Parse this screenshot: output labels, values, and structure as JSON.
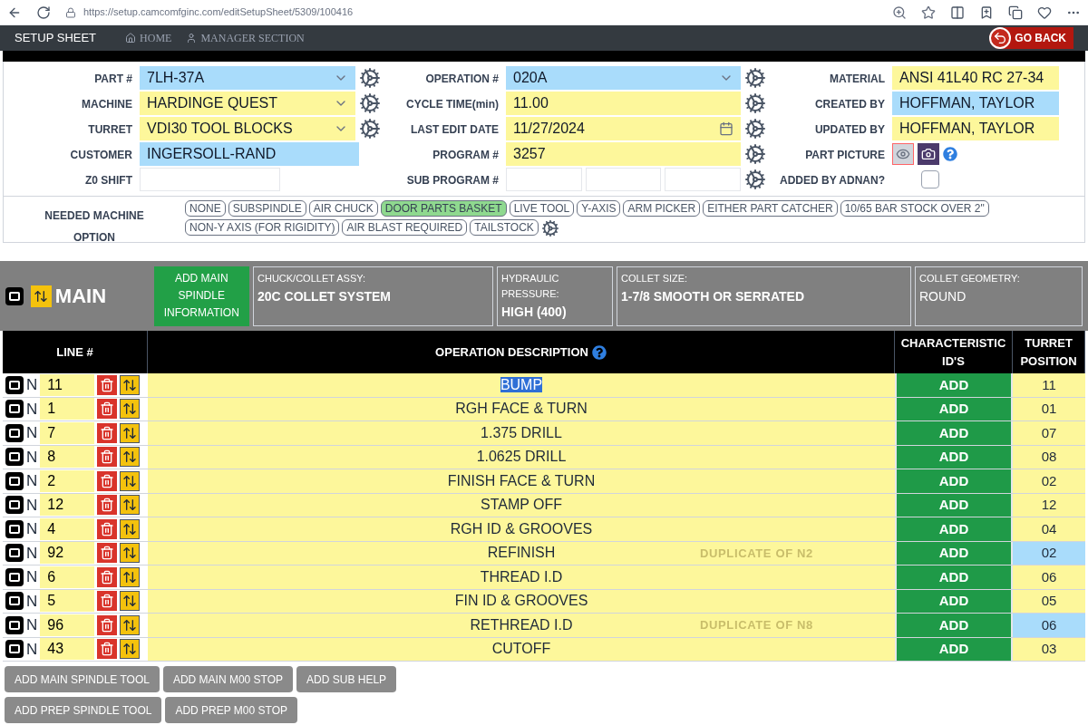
{
  "browser": {
    "url": "https://setup.camcomfginc.com/editSetupSheet/5309/100416"
  },
  "nav": {
    "title": "SETUP SHEET",
    "links": [
      "HOME",
      "MANAGER SECTION"
    ],
    "back_button": "GO BACK"
  },
  "general": {
    "columns": [
      [
        {
          "label": "PART #",
          "value": "7LH-37A",
          "kind": "select",
          "color": "#a9dcfb",
          "gear": true
        },
        {
          "label": "MACHINE",
          "value": "HARDINGE QUEST",
          "kind": "select",
          "color": "#fdf79b",
          "gear": true
        },
        {
          "label": "TURRET",
          "value": "VDI30 TOOL BLOCKS",
          "kind": "select",
          "color": "#fdf79b",
          "gear": true
        },
        {
          "label": "CUSTOMER",
          "value": "INGERSOLL-RAND",
          "kind": "text",
          "color": "#a9dcfb",
          "gear": false
        },
        {
          "label": "Z0 SHIFT",
          "kind": "short",
          "gear": false
        }
      ],
      [
        {
          "label": "OPERATION #",
          "value": "020A",
          "kind": "select",
          "color": "#a9dcfb",
          "gear": true
        },
        {
          "label": "CYCLE TIME(min)",
          "value": "11.00",
          "kind": "text",
          "color": "#fdf79b",
          "gear": true
        },
        {
          "label": "LAST EDIT DATE",
          "value": "11/27/2024",
          "kind": "date",
          "color": "#fdf79b",
          "gear": true
        },
        {
          "label": "PROGRAM #",
          "value": "3257",
          "kind": "text",
          "color": "#fdf79b",
          "gear": true
        },
        {
          "label": "SUB PROGRAM #",
          "kind": "triple",
          "gear": true
        }
      ],
      [
        {
          "label": "MATERIAL",
          "value": "ANSI 41L40 RC 27-34",
          "kind": "text",
          "color": "#fdf79b",
          "gear": false
        },
        {
          "label": "CREATED BY",
          "value": "HOFFMAN, TAYLOR",
          "kind": "text",
          "color": "#a9dcfb",
          "gear": false
        },
        {
          "label": "UPDATED BY",
          "value": "HOFFMAN, TAYLOR",
          "kind": "text",
          "color": "#fdf79b",
          "gear": false
        },
        {
          "label": "PART PICTURE",
          "kind": "picture",
          "gear": false
        },
        {
          "label": "ADDED BY ADNAN?",
          "kind": "checkbox",
          "checked": false,
          "gear": false
        }
      ]
    ]
  },
  "machine_options": {
    "label": "NEEDED MACHINE OPTION",
    "options": [
      {
        "label": "NONE",
        "selected": false
      },
      {
        "label": "SUBSPINDLE",
        "selected": false
      },
      {
        "label": "AIR CHUCK",
        "selected": false
      },
      {
        "label": "DOOR PARTS BASKET",
        "selected": true
      },
      {
        "label": "LIVE TOOL",
        "selected": false
      },
      {
        "label": "Y-AXIS",
        "selected": false
      },
      {
        "label": "ARM PICKER",
        "selected": false
      },
      {
        "label": "EITHER PART CATCHER",
        "selected": false
      },
      {
        "label": "10/65 BAR STOCK OVER 2\"",
        "selected": false
      },
      {
        "label": "NON-Y AXIS (FOR RIGIDITY)",
        "selected": false
      },
      {
        "label": "AIR BLAST REQUIRED",
        "selected": false
      },
      {
        "label": "TAILSTOCK",
        "selected": false
      }
    ]
  },
  "main": {
    "title": "MAIN",
    "add_button": "ADD MAIN SPINDLE INFORMATION",
    "info": [
      {
        "label": "CHUCK/COLLET ASSY:",
        "value": "20C COLLET SYSTEM",
        "kind": "bold"
      },
      {
        "label": "HYDRAULIC PRESSURE:",
        "value": "HIGH (400)",
        "kind": "bold"
      },
      {
        "label": "COLLET SIZE:",
        "value": "1-7/8 SMOOTH OR SERRATED",
        "kind": "bold"
      },
      {
        "label": "COLLET GEOMETRY:",
        "value": "ROUND",
        "kind": "plain"
      }
    ]
  },
  "table": {
    "columns": [
      "LINE #",
      "OPERATION DESCRIPTION",
      "CHARACTERISTIC ID'S",
      "TURRET POSITION"
    ],
    "rows": [
      {
        "prefix": "N",
        "line": "11",
        "description": "BUMP",
        "action": "ADD",
        "turret": "11",
        "selected": true
      },
      {
        "prefix": "N",
        "line": "1",
        "description": "RGH FACE & TURN",
        "action": "ADD",
        "turret": "01",
        "selected": false
      },
      {
        "prefix": "N",
        "line": "7",
        "description": "1.375 DRILL",
        "action": "ADD",
        "turret": "07",
        "selected": false
      },
      {
        "prefix": "N",
        "line": "8",
        "description": "1.0625 DRILL",
        "action": "ADD",
        "turret": "08",
        "selected": false
      },
      {
        "prefix": "N",
        "line": "2",
        "description": "FINISH FACE & TURN",
        "action": "ADD",
        "turret": "02",
        "selected": false
      },
      {
        "prefix": "N",
        "line": "12",
        "description": "STAMP OFF",
        "action": "ADD",
        "turret": "12",
        "selected": false
      },
      {
        "prefix": "N",
        "line": "4",
        "description": "RGH ID & GROOVES",
        "action": "ADD",
        "turret": "04",
        "selected": false
      },
      {
        "prefix": "N",
        "line": "92",
        "description": "REFINISH",
        "duplicate": "DUPLICATE OF N2",
        "action": "ADD",
        "turret": "02",
        "selected": false
      },
      {
        "prefix": "N",
        "line": "6",
        "description": "THREAD I.D",
        "action": "ADD",
        "turret": "06",
        "selected": false
      },
      {
        "prefix": "N",
        "line": "5",
        "description": "FIN ID & GROOVES",
        "action": "ADD",
        "turret": "05",
        "selected": false
      },
      {
        "prefix": "N",
        "line": "96",
        "description": "RETHREAD I.D",
        "duplicate": "DUPLICATE OF N8",
        "action": "ADD",
        "turret": "06",
        "selected": false
      },
      {
        "prefix": "N",
        "line": "43",
        "description": "CUTOFF",
        "action": "ADD",
        "turret": "03",
        "selected": false
      }
    ]
  },
  "buttons": [
    [
      "ADD MAIN SPINDLE TOOL",
      "ADD MAIN M00 STOP",
      "ADD SUB HELP"
    ],
    [
      "ADD PREP SPINDLE TOOL",
      "ADD PREP M00 STOP"
    ]
  ]
}
